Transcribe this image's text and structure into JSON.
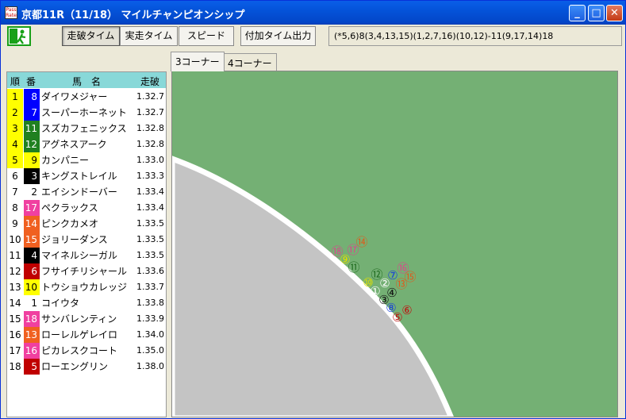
{
  "window": {
    "title": "京都11R（11/18） マイルチャンピオンシップ",
    "icon_text": "Pass Rate",
    "controls": [
      "minimize",
      "maximize",
      "close"
    ]
  },
  "toolbar": {
    "buttons": [
      "走破タイム",
      "実走タイム",
      "スピード",
      "付加タイム出力"
    ],
    "active_button": "走破タイム",
    "order": "(*5,6)8(3,4,13,15)(1,2,7,16)(10,12)-11(9,17,14)18"
  },
  "tabs": [
    "3コーナー",
    "4コーナー"
  ],
  "active_tab": "3コーナー",
  "table": {
    "headers": [
      "順",
      "番",
      "馬　名",
      "走破"
    ],
    "rows": [
      {
        "rank": "1",
        "num": "8",
        "name": "ダイワメジャー",
        "time": "1.32.7",
        "rank_bg": "#ffff00",
        "num_bg": "#0000ff",
        "num_fg": "#ffffff"
      },
      {
        "rank": "2",
        "num": "7",
        "name": "スーパーホーネット",
        "time": "1.32.7",
        "rank_bg": "#ffff00",
        "num_bg": "#0000ff",
        "num_fg": "#ffffff"
      },
      {
        "rank": "3",
        "num": "11",
        "name": "スズカフェニックス",
        "time": "1.32.8",
        "rank_bg": "#ffff00",
        "num_bg": "#208020",
        "num_fg": "#ffffff"
      },
      {
        "rank": "4",
        "num": "12",
        "name": "アグネスアーク",
        "time": "1.32.8",
        "rank_bg": "#ffff00",
        "num_bg": "#208020",
        "num_fg": "#ffffff"
      },
      {
        "rank": "5",
        "num": "9",
        "name": "カンパニー",
        "time": "1.33.0",
        "rank_bg": "#ffff00",
        "num_bg": "#ffff00",
        "num_fg": "#000000"
      },
      {
        "rank": "6",
        "num": "3",
        "name": "キングストレイル",
        "time": "1.33.3",
        "rank_bg": "#ffffff",
        "num_bg": "#000000",
        "num_fg": "#ffffff"
      },
      {
        "rank": "7",
        "num": "2",
        "name": "エイシンドーバー",
        "time": "1.33.4",
        "rank_bg": "#ffffff",
        "num_bg": "#ffffff",
        "num_fg": "#000000"
      },
      {
        "rank": "8",
        "num": "17",
        "name": "ペクラックス",
        "time": "1.33.4",
        "rank_bg": "#ffffff",
        "num_bg": "#f040a0",
        "num_fg": "#ffffff"
      },
      {
        "rank": "9",
        "num": "14",
        "name": "ピンクカメオ",
        "time": "1.33.5",
        "rank_bg": "#ffffff",
        "num_bg": "#f06020",
        "num_fg": "#ffffff"
      },
      {
        "rank": "10",
        "num": "15",
        "name": "ジョリーダンス",
        "time": "1.33.5",
        "rank_bg": "#ffffff",
        "num_bg": "#f06020",
        "num_fg": "#ffffff"
      },
      {
        "rank": "11",
        "num": "4",
        "name": "マイネルシーガル",
        "time": "1.33.5",
        "rank_bg": "#ffffff",
        "num_bg": "#000000",
        "num_fg": "#ffffff"
      },
      {
        "rank": "12",
        "num": "6",
        "name": "フサイチリシャール",
        "time": "1.33.6",
        "rank_bg": "#ffffff",
        "num_bg": "#c00000",
        "num_fg": "#ffffff"
      },
      {
        "rank": "13",
        "num": "10",
        "name": "トウショウカレッジ",
        "time": "1.33.7",
        "rank_bg": "#ffffff",
        "num_bg": "#ffff00",
        "num_fg": "#000000"
      },
      {
        "rank": "14",
        "num": "1",
        "name": "コイウタ",
        "time": "1.33.8",
        "rank_bg": "#ffffff",
        "num_bg": "#ffffff",
        "num_fg": "#000000"
      },
      {
        "rank": "15",
        "num": "18",
        "name": "サンバレンティン",
        "time": "1.33.9",
        "rank_bg": "#ffffff",
        "num_bg": "#f040a0",
        "num_fg": "#ffffff"
      },
      {
        "rank": "16",
        "num": "13",
        "name": "ローレルゲレイロ",
        "time": "1.34.0",
        "rank_bg": "#ffffff",
        "num_bg": "#f06020",
        "num_fg": "#ffffff"
      },
      {
        "rank": "17",
        "num": "16",
        "name": "ピカレスクコート",
        "time": "1.35.0",
        "rank_bg": "#ffffff",
        "num_bg": "#f040a0",
        "num_fg": "#ffffff"
      },
      {
        "rank": "18",
        "num": "5",
        "name": "ローエングリン",
        "time": "1.38.0",
        "rank_bg": "#ffffff",
        "num_bg": "#c00000",
        "num_fg": "#ffffff"
      }
    ]
  },
  "markers": [
    {
      "num": "⑱",
      "color": "#e0408c"
    },
    {
      "num": "⑰",
      "color": "#e0408c"
    },
    {
      "num": "⑭",
      "color": "#e05a1a"
    },
    {
      "num": "⑨",
      "color": "#e0e000"
    },
    {
      "num": "⑪",
      "color": "#1e6a1e"
    },
    {
      "num": "⑫",
      "color": "#1e6a1e"
    },
    {
      "num": "⑦",
      "color": "#1a44d8"
    },
    {
      "num": "⑯",
      "color": "#e0408c"
    },
    {
      "num": "⑮",
      "color": "#e05a1a"
    },
    {
      "num": "⑩",
      "color": "#e0e000"
    },
    {
      "num": "②",
      "color": "#ffffff"
    },
    {
      "num": "⑬",
      "color": "#e05a1a"
    },
    {
      "num": "①",
      "color": "#ffffff"
    },
    {
      "num": "④",
      "color": "#111111"
    },
    {
      "num": "③",
      "color": "#111111"
    },
    {
      "num": "⑧",
      "color": "#1a44d8"
    },
    {
      "num": "⑥",
      "color": "#c01010"
    },
    {
      "num": "⑤",
      "color": "#c01010"
    }
  ]
}
